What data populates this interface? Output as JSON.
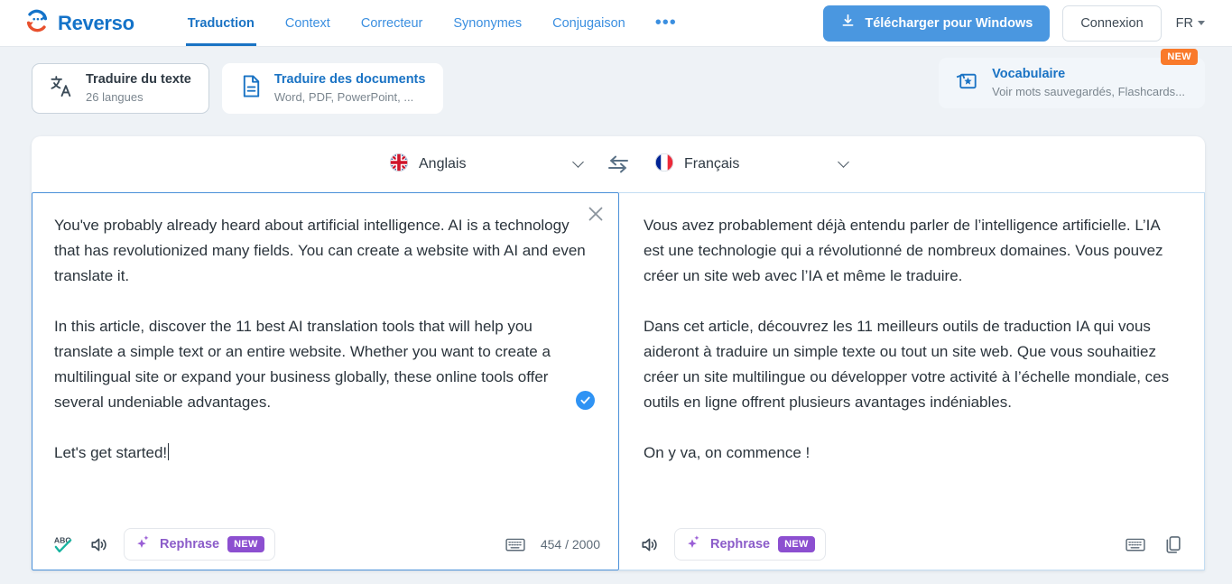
{
  "header": {
    "logo_text": "Reverso",
    "logo_icon": "reverso-circular-arrows-icon",
    "nav": [
      {
        "label": "Traduction",
        "active": true
      },
      {
        "label": "Context",
        "active": false
      },
      {
        "label": "Correcteur",
        "active": false
      },
      {
        "label": "Synonymes",
        "active": false
      },
      {
        "label": "Conjugaison",
        "active": false
      }
    ],
    "more_label": "•••",
    "download_label": "Télécharger pour Windows",
    "download_icon": "download-icon",
    "login_label": "Connexion",
    "ui_language": "FR",
    "accent_blue": "#4a97e0"
  },
  "modes": {
    "text": {
      "icon": "translate-text-icon",
      "title": "Traduire du texte",
      "subtitle": "26 langues",
      "selected": true
    },
    "documents": {
      "icon": "document-icon",
      "title": "Traduire des documents",
      "subtitle": "Word, PDF, PowerPoint, ...",
      "selected": false
    },
    "vocabulary": {
      "icon": "flashcards-star-icon",
      "title": "Vocabulaire",
      "subtitle": "Voir mots sauvegardés, Flashcards...",
      "badge": "NEW",
      "badge_color": "#f97a2b"
    }
  },
  "translator": {
    "source_language": "Anglais",
    "source_flag": "uk-flag-icon",
    "target_language": "Français",
    "target_flag": "france-flag-icon",
    "swap_icon": "swap-arrows-icon",
    "source_text": "You've probably already heard about artificial intelligence. AI is a technology that has revolutionized many fields. You can create a website with AI and even translate it.\n\nIn this article, discover the 11 best AI translation tools that will help you translate a simple text or an entire website. Whether you want to create a multilingual site or expand your business globally, these online tools offer several undeniable advantages.\n\nLet's get started!",
    "target_text": "Vous avez probablement déjà entendu parler de l’intelligence artificielle. L’IA est une technologie qui a révolutionné de nombreux domaines. Vous pouvez créer un site web avec l’IA et même le traduire.\n\nDans cet article, découvrez les 11 meilleurs outils de traduction IA qui vous aideront à traduire un simple texte ou tout un site web. Que vous souhaitiez créer un site multilingue ou développer votre activité à l’échelle mondiale, ces outils en ligne offrent plusieurs avantages indéniables.\n\nOn y va, on commence !",
    "close_icon": "close-icon",
    "validated_icon": "check-circle-icon",
    "source_toolbar": {
      "spellcheck_icon": "abc-spellcheck-icon",
      "speaker_icon": "speaker-icon",
      "rephrase_label": "Rephrase",
      "rephrase_icon": "sparkle-icon",
      "rephrase_badge": "NEW",
      "keyboard_icon": "keyboard-icon",
      "char_counter": "454 / 2000"
    },
    "target_toolbar": {
      "speaker_icon": "speaker-icon",
      "rephrase_label": "Rephrase",
      "rephrase_icon": "sparkle-icon",
      "rephrase_badge": "NEW",
      "keyboard_icon": "keyboard-icon",
      "copy_icon": "copy-icon"
    }
  }
}
